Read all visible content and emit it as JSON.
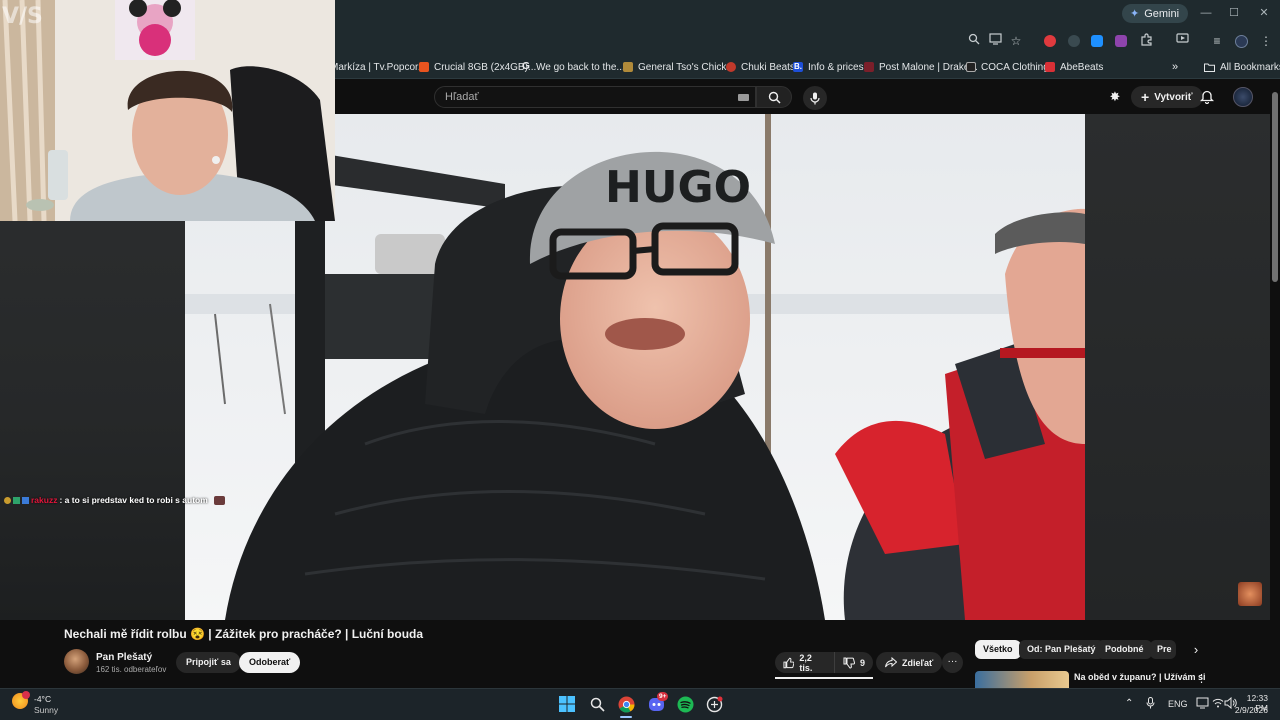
{
  "browser": {
    "gemini_label": "Gemini",
    "bookmarks": [
      {
        "label": "Markíza | Tv.Popcor...",
        "color": "#1f2a2e"
      },
      {
        "label": "Crucial 8GB (2x4GB)...",
        "color": "#e8541f"
      },
      {
        "label": "We go back to the...",
        "color": "#4285f4"
      },
      {
        "label": "General Tso's Chick...",
        "color": "#b08a3a"
      },
      {
        "label": "Chuki Beats",
        "color": "#c0392b"
      },
      {
        "label": "Info & prices",
        "color": "#1d4fd8"
      },
      {
        "label": "Post Malone | Drake...",
        "color": "#7b1f2a"
      },
      {
        "label": "COCA Clothing",
        "color": "#222222"
      },
      {
        "label": "AbeBeats",
        "color": "#d93036"
      }
    ],
    "all_bookmarks": "All Bookmarks"
  },
  "youtube": {
    "search_placeholder": "Hľadať",
    "create_label": "Vytvoriť"
  },
  "stream_overlay": {
    "chat_username": "rakuzz",
    "chat_message": ": a to si predstav ked to robi s autom"
  },
  "video": {
    "title": "Nechali mě řídit rolbu 😵 | Zážitek pro pracháče? | Luční bouda",
    "channel": "Pan Plešatý",
    "subscribers": "162 tis. odberateľov",
    "join_label": "Pripojiť sa",
    "subscribe_label": "Odoberať",
    "likes": "2,2 tis.",
    "dislikes": "9",
    "share_label": "Zdieľať",
    "more_label": "···"
  },
  "related": {
    "chips": [
      "Všetko",
      "Od: Pan Plešatý",
      "Podobné",
      "Pre"
    ],
    "first_title": "Na oběd v županu? | Užívám si"
  },
  "taskbar": {
    "weather_temp": "-4°C",
    "weather_desc": "Sunny",
    "language": "ENG",
    "time": "12:33 PM",
    "date": "2/9/2026",
    "discord_badge": "9+"
  },
  "colors": {
    "accent_red": "#ff0000",
    "chrome_bg": "#1f2a2e",
    "yt_bg": "#0f0f0f"
  }
}
